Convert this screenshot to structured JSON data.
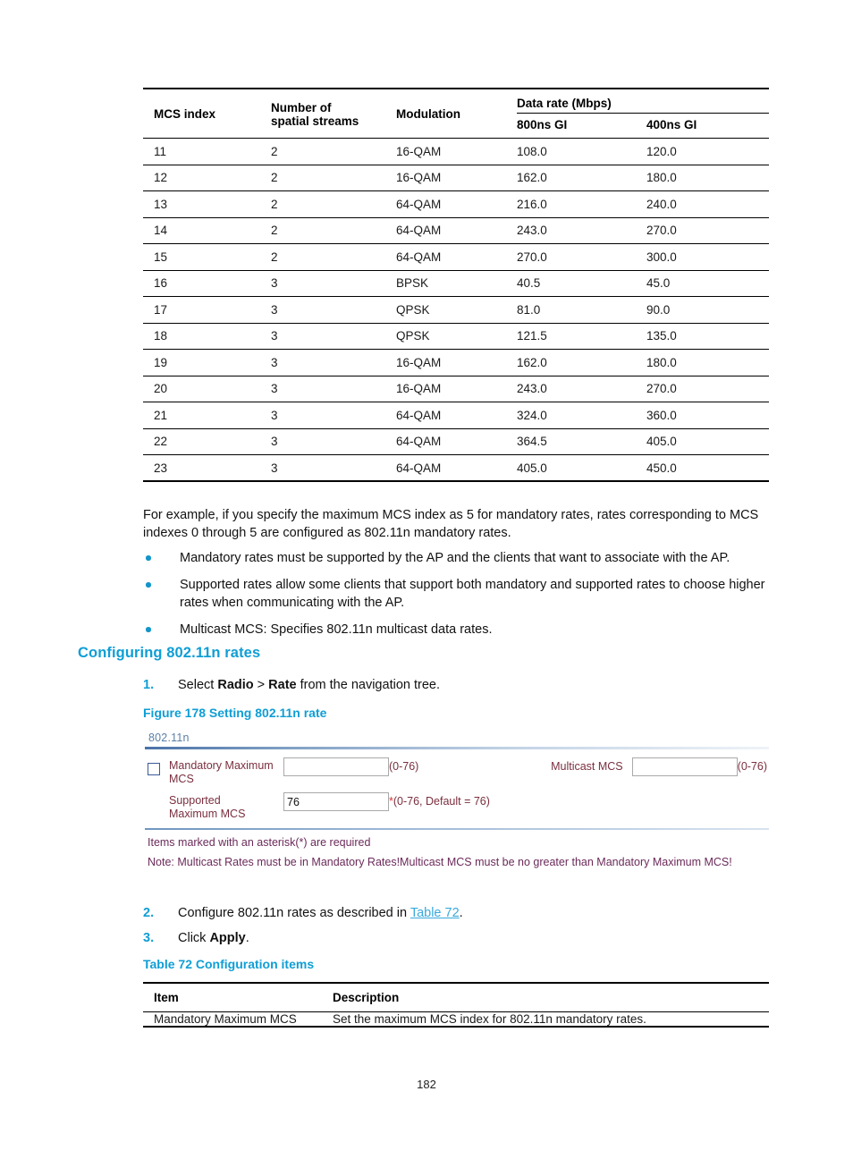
{
  "mcs_table": {
    "headers": {
      "mcs_index": "MCS index",
      "spatial_streams": "Number of\nspatial streams",
      "spatial_streams_line1": "Number of",
      "spatial_streams_line2": "spatial streams",
      "modulation": "Modulation",
      "data_rate_group": "Data rate (Mbps)",
      "gi_800": "800ns GI",
      "gi_400": "400ns GI"
    },
    "rows": [
      {
        "mcs_index": "11",
        "spatial_streams": "2",
        "modulation": "16-QAM",
        "gi_800": "108.0",
        "gi_400": "120.0"
      },
      {
        "mcs_index": "12",
        "spatial_streams": "2",
        "modulation": "16-QAM",
        "gi_800": "162.0",
        "gi_400": "180.0"
      },
      {
        "mcs_index": "13",
        "spatial_streams": "2",
        "modulation": "64-QAM",
        "gi_800": "216.0",
        "gi_400": "240.0"
      },
      {
        "mcs_index": "14",
        "spatial_streams": "2",
        "modulation": "64-QAM",
        "gi_800": "243.0",
        "gi_400": "270.0"
      },
      {
        "mcs_index": "15",
        "spatial_streams": "2",
        "modulation": "64-QAM",
        "gi_800": "270.0",
        "gi_400": "300.0"
      },
      {
        "mcs_index": "16",
        "spatial_streams": "3",
        "modulation": "BPSK",
        "gi_800": "40.5",
        "gi_400": "45.0"
      },
      {
        "mcs_index": "17",
        "spatial_streams": "3",
        "modulation": "QPSK",
        "gi_800": "81.0",
        "gi_400": "90.0"
      },
      {
        "mcs_index": "18",
        "spatial_streams": "3",
        "modulation": "QPSK",
        "gi_800": "121.5",
        "gi_400": "135.0"
      },
      {
        "mcs_index": "19",
        "spatial_streams": "3",
        "modulation": "16-QAM",
        "gi_800": "162.0",
        "gi_400": "180.0"
      },
      {
        "mcs_index": "20",
        "spatial_streams": "3",
        "modulation": "16-QAM",
        "gi_800": "243.0",
        "gi_400": "270.0"
      },
      {
        "mcs_index": "21",
        "spatial_streams": "3",
        "modulation": "64-QAM",
        "gi_800": "324.0",
        "gi_400": "360.0"
      },
      {
        "mcs_index": "22",
        "spatial_streams": "3",
        "modulation": "64-QAM",
        "gi_800": "364.5",
        "gi_400": "405.0"
      },
      {
        "mcs_index": "23",
        "spatial_streams": "3",
        "modulation": "64-QAM",
        "gi_800": "405.0",
        "gi_400": "450.0"
      }
    ]
  },
  "body": {
    "example_paragraph": "For example, if you specify the maximum MCS index as 5 for mandatory rates, rates corresponding to MCS indexes 0 through 5 are configured as 802.11n mandatory rates.",
    "bullets": [
      "Mandatory rates must be supported by the AP and the clients that want to associate with the AP.",
      "Supported rates allow some clients that support both mandatory and supported rates to choose higher rates when communicating with the AP.",
      "Multicast MCS: Specifies 802.11n multicast data rates."
    ]
  },
  "section": {
    "heading": "Configuring 802.11n rates"
  },
  "steps": {
    "step1": {
      "number": "1.",
      "prefix": "Select ",
      "bold1": "Radio",
      "sep": " > ",
      "bold2": "Rate",
      "suffix": " from the navigation tree."
    },
    "step2": {
      "number": "2.",
      "prefix": "Configure 802.11n rates as described in ",
      "link": "Table 72",
      "suffix": "."
    },
    "step3": {
      "number": "3.",
      "prefix": "Click ",
      "bold": "Apply",
      "suffix": "."
    }
  },
  "captions": {
    "figure": "Figure 178 Setting 802.11n rate",
    "table": "Table 72 Configuration items"
  },
  "figure": {
    "section_title": "802.11n",
    "mandatory_label_line1": "Mandatory Maximum",
    "mandatory_label_line2": "MCS",
    "mandatory_value": "",
    "mandatory_hint": "(0-76)",
    "supported_label_line1": "Supported",
    "supported_label_line2": "Maximum MCS",
    "supported_value": "76",
    "supported_star": "*",
    "supported_hint": "(0-76, Default = 76)",
    "multicast_label": "Multicast MCS",
    "multicast_value": "",
    "multicast_hint": "(0-76)",
    "note_required": "Items marked with an asterisk(*) are required",
    "note_multicast": "Note: Multicast Rates must be in Mandatory Rates!Multicast MCS must be no greater than Mandatory Maximum MCS!",
    "colors": {
      "label": "#7a2f3f",
      "note": "#6b2a5a",
      "section_title": "#5b7fa6",
      "checkbox_border": "#3b5998",
      "required_star": "#e03030"
    }
  },
  "config_table": {
    "headers": {
      "item": "Item",
      "description": "Description"
    },
    "rows": [
      {
        "item": "Mandatory Maximum MCS",
        "description": "Set the maximum MCS index for 802.11n mandatory rates."
      }
    ]
  },
  "footer": {
    "page_number": "182"
  },
  "theme": {
    "accent_blue": "#0f9ed5",
    "link_blue": "#39a9dc",
    "bullet_blue": "#1295c9"
  }
}
